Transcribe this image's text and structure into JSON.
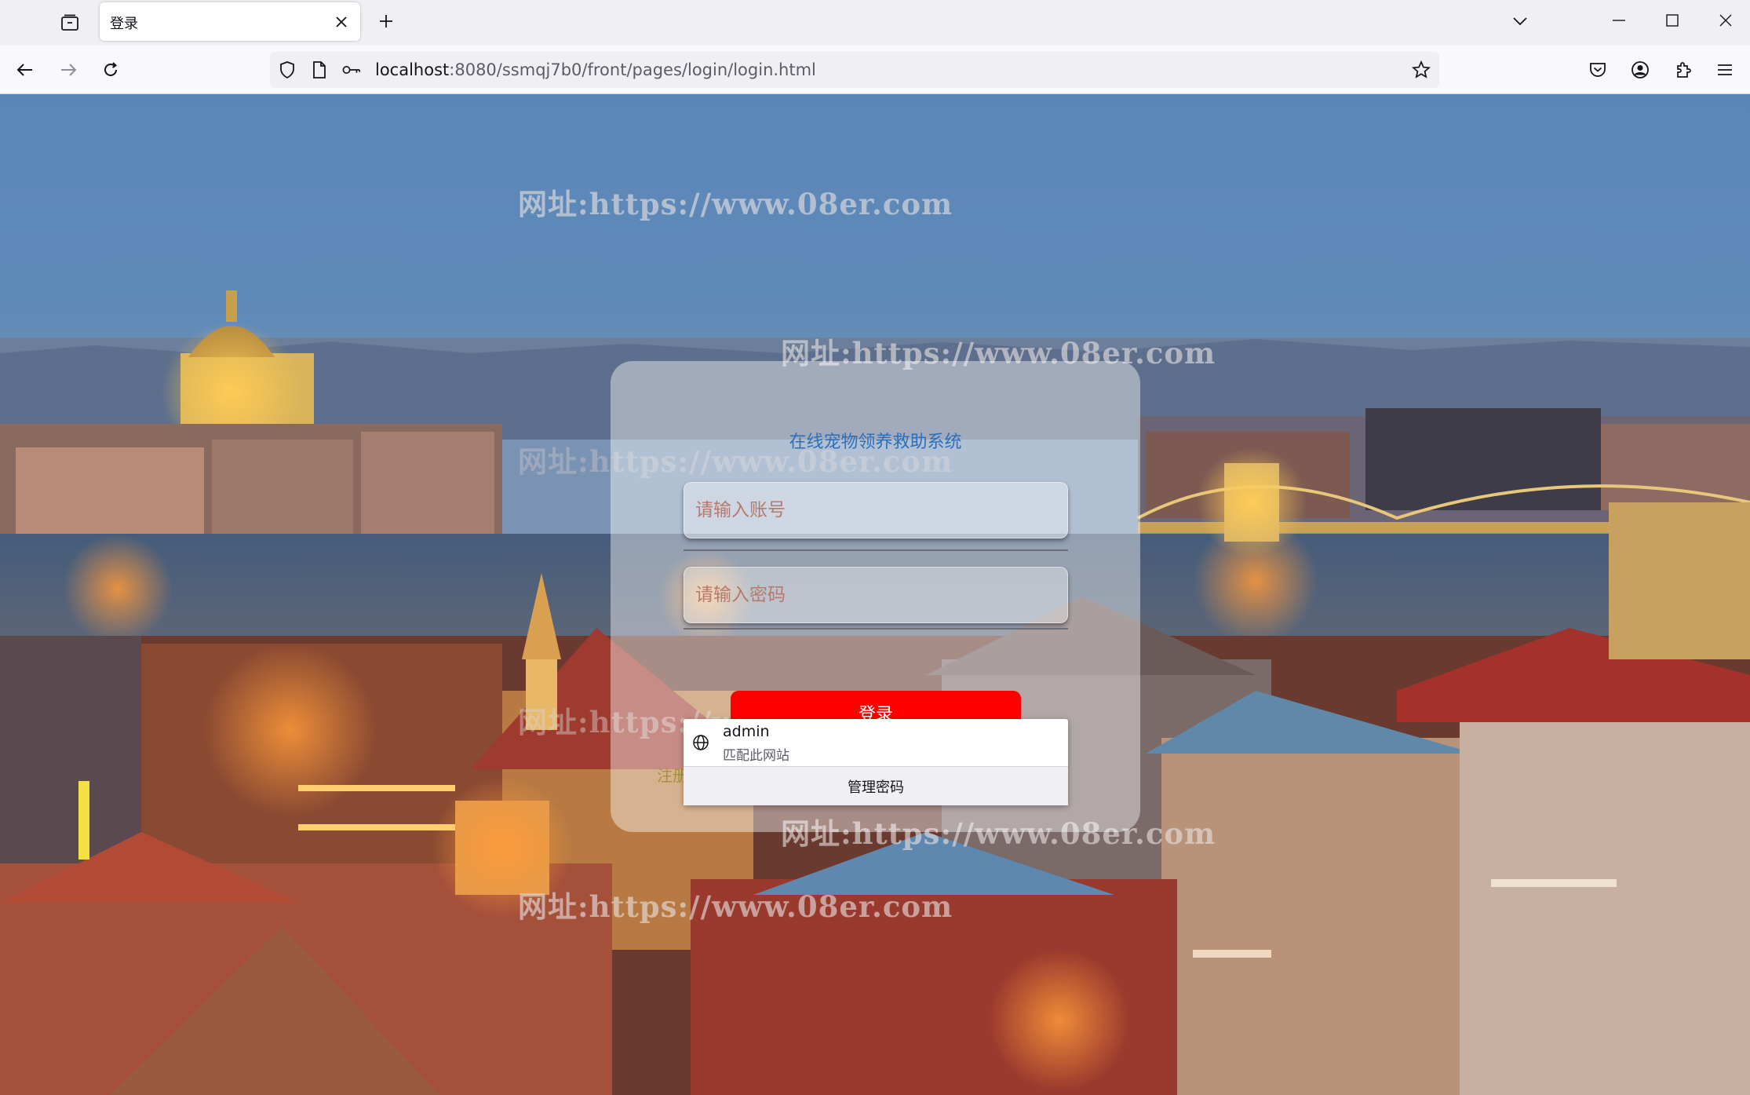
{
  "browser": {
    "tab_title": "登录",
    "url_host": "localhost",
    "url_rest": ":8080/ssmqj7b0/front/pages/login/login.html"
  },
  "watermark": {
    "text": "网址:https://www.08er.com"
  },
  "login": {
    "title": "在线宠物领养救助系统",
    "username_placeholder": "请输入账号",
    "password_placeholder": "请输入密码",
    "login_button": "登录",
    "register_link": "注册用户"
  },
  "autocomplete": {
    "username": "admin",
    "subtitle": "匹配此网站",
    "manage_label": "管理密码"
  },
  "colors": {
    "title": "#2c6fb8",
    "login_button_bg": "#ff0000",
    "register_link": "#a39437"
  }
}
